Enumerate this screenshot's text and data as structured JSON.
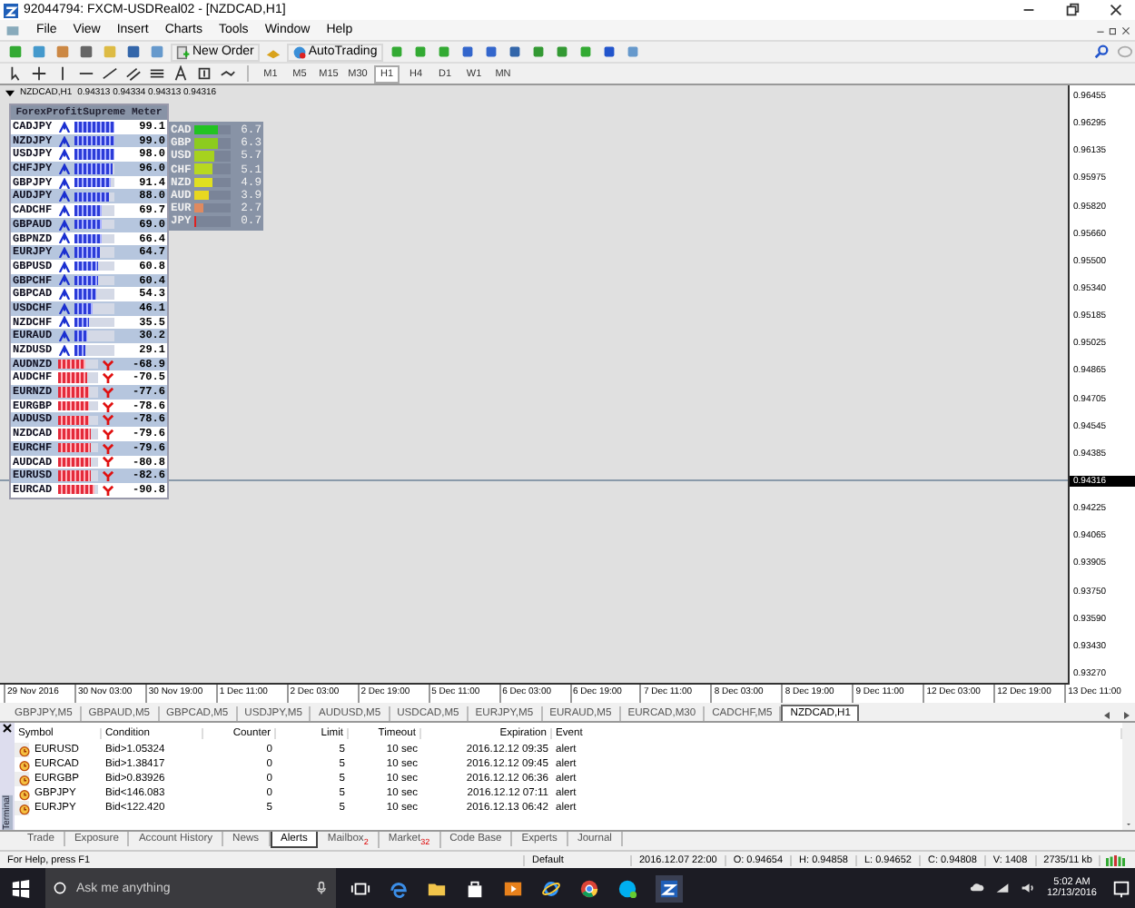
{
  "window": {
    "title": "92044794: FXCM-USDReal02 - [NZDCAD,H1]"
  },
  "menu": [
    "File",
    "View",
    "Insert",
    "Charts",
    "Tools",
    "Window",
    "Help"
  ],
  "toolbar": {
    "buttons": [
      "New Order",
      "AutoTrading"
    ],
    "timeframes": [
      {
        "label": "M1",
        "selected": false
      },
      {
        "label": "M5",
        "selected": false
      },
      {
        "label": "M15",
        "selected": false
      },
      {
        "label": "M30",
        "selected": false
      },
      {
        "label": "H1",
        "selected": true
      },
      {
        "label": "H4",
        "selected": false
      },
      {
        "label": "D1",
        "selected": false
      },
      {
        "label": "W1",
        "selected": false
      },
      {
        "label": "MN",
        "selected": false
      }
    ]
  },
  "chart": {
    "header": {
      "symbol": "NZDCAD,H1",
      "prices": "0.94313 0.94334 0.94313 0.94316"
    },
    "meter": {
      "title": "ForexProfitSupreme Meter",
      "rows": [
        {
          "pair": "CADJPY",
          "kind": "up",
          "level": 0.99,
          "value": "99.1"
        },
        {
          "pair": "NZDJPY",
          "kind": "up",
          "level": 0.99,
          "value": "99.0"
        },
        {
          "pair": "USDJPY",
          "kind": "up",
          "level": 0.98,
          "value": "98.0"
        },
        {
          "pair": "CHFJPY",
          "kind": "up",
          "level": 0.96,
          "value": "96.0"
        },
        {
          "pair": "GBPJPY",
          "kind": "up",
          "level": 0.91,
          "value": "91.4"
        },
        {
          "pair": "AUDJPY",
          "kind": "up",
          "level": 0.88,
          "value": "88.0"
        },
        {
          "pair": "CADCHF",
          "kind": "up",
          "level": 0.7,
          "value": "69.7"
        },
        {
          "pair": "GBPAUD",
          "kind": "up",
          "level": 0.69,
          "value": "69.0"
        },
        {
          "pair": "GBPNZD",
          "kind": "up",
          "level": 0.66,
          "value": "66.4"
        },
        {
          "pair": "EURJPY",
          "kind": "up",
          "level": 0.65,
          "value": "64.7"
        },
        {
          "pair": "GBPUSD",
          "kind": "up",
          "level": 0.61,
          "value": "60.8"
        },
        {
          "pair": "GBPCHF",
          "kind": "up",
          "level": 0.6,
          "value": "60.4"
        },
        {
          "pair": "GBPCAD",
          "kind": "up",
          "level": 0.54,
          "value": "54.3"
        },
        {
          "pair": "USDCHF",
          "kind": "up",
          "level": 0.46,
          "value": "46.1"
        },
        {
          "pair": "NZDCHF",
          "kind": "up",
          "level": 0.36,
          "value": "35.5"
        },
        {
          "pair": "EURAUD",
          "kind": "up",
          "level": 0.3,
          "value": "30.2"
        },
        {
          "pair": "NZDUSD",
          "kind": "up",
          "level": 0.29,
          "value": "29.1"
        },
        {
          "pair": "AUDNZD",
          "kind": "down",
          "level": 0.69,
          "value": "-68.9"
        },
        {
          "pair": "AUDCHF",
          "kind": "down",
          "level": 0.71,
          "value": "-70.5"
        },
        {
          "pair": "EURNZD",
          "kind": "down",
          "level": 0.78,
          "value": "-77.6"
        },
        {
          "pair": "EURGBP",
          "kind": "down",
          "level": 0.79,
          "value": "-78.6"
        },
        {
          "pair": "AUDUSD",
          "kind": "down",
          "level": 0.79,
          "value": "-78.6"
        },
        {
          "pair": "NZDCAD",
          "kind": "down",
          "level": 0.8,
          "value": "-79.6"
        },
        {
          "pair": "EURCHF",
          "kind": "down",
          "level": 0.8,
          "value": "-79.6"
        },
        {
          "pair": "AUDCAD",
          "kind": "down",
          "level": 0.81,
          "value": "-80.8"
        },
        {
          "pair": "EURUSD",
          "kind": "down",
          "level": 0.83,
          "value": "-82.6"
        },
        {
          "pair": "EURCAD",
          "kind": "down",
          "level": 0.91,
          "value": "-90.8"
        }
      ]
    },
    "strength": [
      {
        "currency": "CAD",
        "level": 0.67,
        "value": "6.7",
        "color": "#22c322"
      },
      {
        "currency": "GBP",
        "level": 0.63,
        "value": "6.3",
        "color": "#8ccc1e"
      },
      {
        "currency": "USD",
        "level": 0.57,
        "value": "5.7",
        "color": "#a6d21e"
      },
      {
        "currency": "CHF",
        "level": 0.51,
        "value": "5.1",
        "color": "#b8d820"
      },
      {
        "currency": "NZD",
        "level": 0.49,
        "value": "4.9",
        "color": "#e0e020"
      },
      {
        "currency": "AUD",
        "level": 0.39,
        "value": "3.9",
        "color": "#e8d820"
      },
      {
        "currency": "EUR",
        "level": 0.27,
        "value": "2.7",
        "color": "#e08a60"
      },
      {
        "currency": "JPY",
        "level": 0.07,
        "value": "0.7",
        "color": "#e02020"
      }
    ],
    "price_axis": [
      {
        "label": "0.96455",
        "current": false
      },
      {
        "label": "0.96295",
        "current": false
      },
      {
        "label": "0.96135",
        "current": false
      },
      {
        "label": "0.95975",
        "current": false
      },
      {
        "label": "0.95820",
        "current": false
      },
      {
        "label": "0.95660",
        "current": false
      },
      {
        "label": "0.95500",
        "current": false
      },
      {
        "label": "0.95340",
        "current": false
      },
      {
        "label": "0.95185",
        "current": false
      },
      {
        "label": "0.95025",
        "current": false
      },
      {
        "label": "0.94865",
        "current": false
      },
      {
        "label": "0.94705",
        "current": false
      },
      {
        "label": "0.94545",
        "current": false
      },
      {
        "label": "0.94385",
        "current": false
      },
      {
        "label": "0.94316",
        "current": true
      },
      {
        "label": "0.94225",
        "current": false
      },
      {
        "label": "0.94065",
        "current": false
      },
      {
        "label": "0.93905",
        "current": false
      },
      {
        "label": "0.93750",
        "current": false
      },
      {
        "label": "0.93590",
        "current": false
      },
      {
        "label": "0.93430",
        "current": false
      },
      {
        "label": "0.93270",
        "current": false
      }
    ],
    "time_axis": [
      "29 Nov 2016",
      "30 Nov 03:00",
      "30 Nov 19:00",
      "1 Dec 11:00",
      "2 Dec 03:00",
      "2 Dec 19:00",
      "5 Dec 11:00",
      "6 Dec 03:00",
      "6 Dec 19:00",
      "7 Dec 11:00",
      "8 Dec 03:00",
      "8 Dec 19:00",
      "9 Dec 11:00",
      "12 Dec 03:00",
      "12 Dec 19:00",
      "13 Dec 11:00"
    ]
  },
  "chart_tabs": [
    {
      "label": "GBPJPY,M5",
      "selected": false
    },
    {
      "label": "GBPAUD,M5",
      "selected": false
    },
    {
      "label": "GBPCAD,M5",
      "selected": false
    },
    {
      "label": "USDJPY,M5",
      "selected": false
    },
    {
      "label": "AUDUSD,M5",
      "selected": false
    },
    {
      "label": "USDCAD,M5",
      "selected": false
    },
    {
      "label": "EURJPY,M5",
      "selected": false
    },
    {
      "label": "EURAUD,M5",
      "selected": false
    },
    {
      "label": "EURCAD,M30",
      "selected": false
    },
    {
      "label": "CADCHF,M5",
      "selected": false
    },
    {
      "label": "NZDCAD,H1",
      "selected": true
    }
  ],
  "terminal": {
    "label": "Terminal",
    "columns": [
      "Symbol",
      "Condition",
      "Counter",
      "Limit",
      "Timeout",
      "Expiration",
      "Event"
    ],
    "rows": [
      [
        "EURUSD",
        "Bid>1.05324",
        "0",
        "5",
        "10 sec",
        "2016.12.12 09:35",
        "alert"
      ],
      [
        "EURCAD",
        "Bid>1.38417",
        "0",
        "5",
        "10 sec",
        "2016.12.12 09:45",
        "alert"
      ],
      [
        "EURGBP",
        "Bid>0.83926",
        "0",
        "5",
        "10 sec",
        "2016.12.12 06:36",
        "alert"
      ],
      [
        "GBPJPY",
        "Bid<146.083",
        "0",
        "5",
        "10 sec",
        "2016.12.12 07:11",
        "alert"
      ],
      [
        "EURJPY",
        "Bid<122.420",
        "5",
        "5",
        "10 sec",
        "2016.12.13 06:42",
        "alert"
      ]
    ],
    "tabs": [
      {
        "label": "Trade",
        "selected": false
      },
      {
        "label": "Exposure",
        "selected": false
      },
      {
        "label": "Account History",
        "selected": false
      },
      {
        "label": "News",
        "selected": false
      },
      {
        "label": "Alerts",
        "selected": true
      },
      {
        "label": "Mailbox",
        "selected": false,
        "badge": "2"
      },
      {
        "label": "Market",
        "selected": false,
        "badge": "32"
      },
      {
        "label": "Code Base",
        "selected": false
      },
      {
        "label": "Experts",
        "selected": false
      },
      {
        "label": "Journal",
        "selected": false
      }
    ]
  },
  "status_bar": [
    "For Help, press F1",
    "Default",
    "2016.12.07 22:00",
    "O: 0.94654",
    "H: 0.94858",
    "L: 0.94652",
    "C: 0.94808",
    "V: 1408",
    "2735/11 kb"
  ],
  "taskbar": {
    "search_placeholder": "Ask me anything",
    "time": "5:02 AM",
    "date": "12/13/2016"
  }
}
